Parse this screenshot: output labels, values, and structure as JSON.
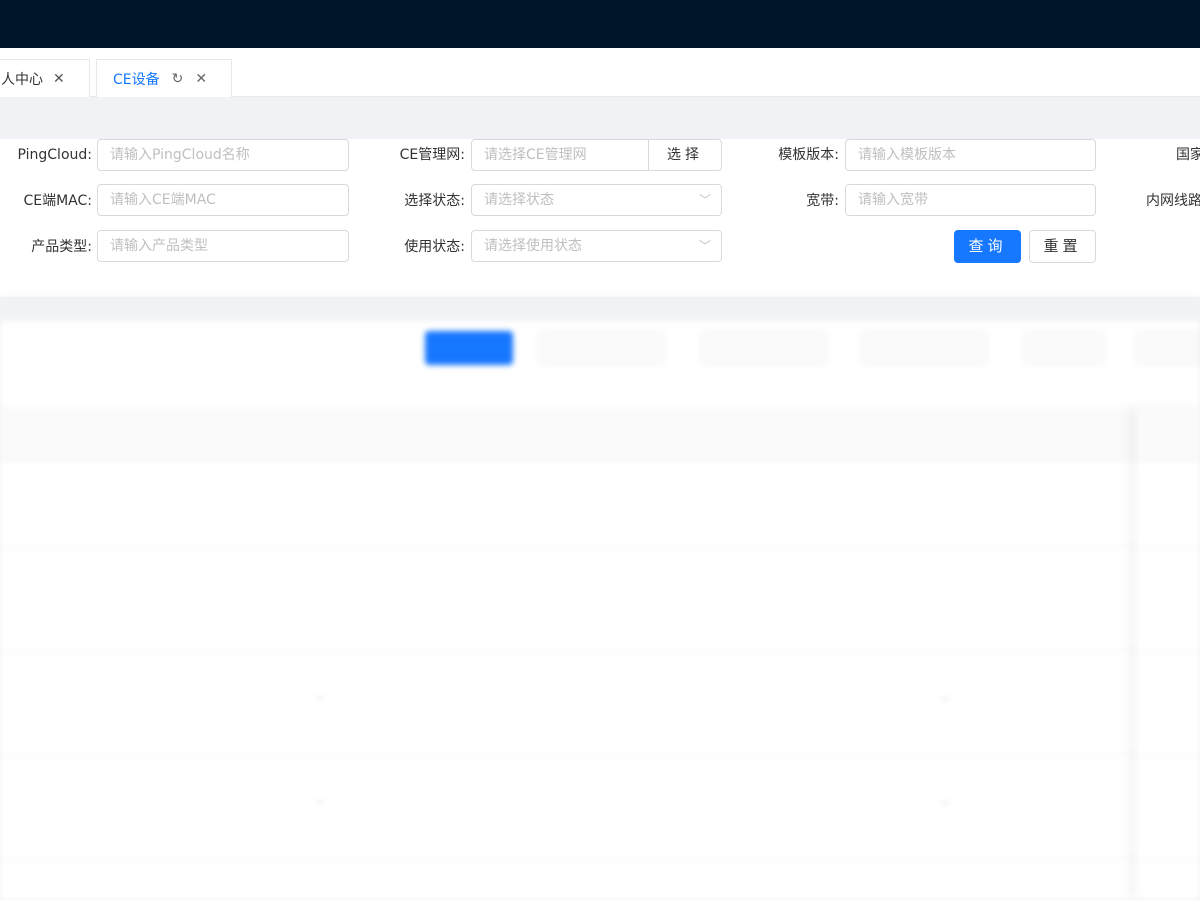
{
  "tabs": [
    {
      "label": "人中心",
      "active": false
    },
    {
      "label": "CE设备",
      "active": true
    }
  ],
  "icons": {
    "close": "close-icon",
    "refresh": "refresh-icon",
    "chevron": "chevron-down-icon"
  },
  "colors": {
    "primary": "#1677ff",
    "header": "#001529"
  },
  "filters": {
    "pingcloud": {
      "label": "PingCloud:",
      "placeholder": "请输入PingCloud名称"
    },
    "ce_mgmt": {
      "label": "CE管理网:",
      "placeholder": "请选择CE管理网",
      "button": "选择"
    },
    "template_version": {
      "label": "模板版本:",
      "placeholder": "请输入模板版本"
    },
    "country": {
      "label": "国家"
    },
    "ce_mac": {
      "label": "CE端MAC:",
      "placeholder": "请输入CE端MAC"
    },
    "select_status": {
      "label": "选择状态:",
      "placeholder": "请选择状态"
    },
    "bandwidth": {
      "label": "宽带:",
      "placeholder": "请输入宽带"
    },
    "intranet_line": {
      "label": "内网线路"
    },
    "product_type": {
      "label": "产品类型:",
      "placeholder": "请输入产品类型"
    },
    "use_status": {
      "label": "使用状态:",
      "placeholder": "请选择使用状态"
    },
    "query_button": "查询",
    "reset_button": "重置"
  },
  "table_rows": [
    {
      "cell_dash_1": "",
      "cell_dash_2": ""
    },
    {
      "cell_dash_1": "",
      "cell_dash_2": ""
    },
    {
      "cell_dash_1": "-",
      "cell_dash_2": "-"
    },
    {
      "cell_dash_1": "-",
      "cell_dash_2": "-"
    }
  ]
}
